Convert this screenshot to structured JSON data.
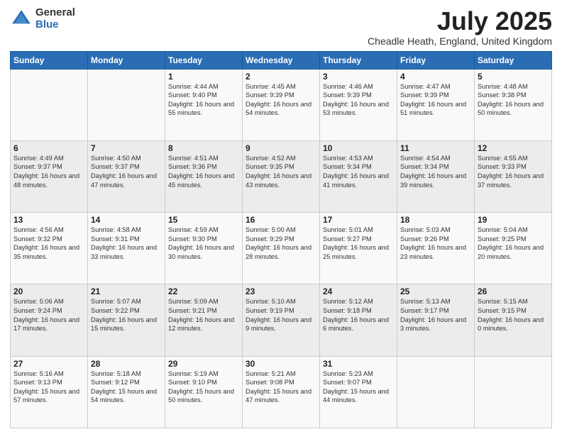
{
  "logo": {
    "general": "General",
    "blue": "Blue"
  },
  "title": {
    "main": "July 2025",
    "sub": "Cheadle Heath, England, United Kingdom"
  },
  "days_of_week": [
    "Sunday",
    "Monday",
    "Tuesday",
    "Wednesday",
    "Thursday",
    "Friday",
    "Saturday"
  ],
  "weeks": [
    [
      {
        "day": "",
        "info": ""
      },
      {
        "day": "",
        "info": ""
      },
      {
        "day": "1",
        "info": "Sunrise: 4:44 AM\nSunset: 9:40 PM\nDaylight: 16 hours and 55 minutes."
      },
      {
        "day": "2",
        "info": "Sunrise: 4:45 AM\nSunset: 9:39 PM\nDaylight: 16 hours and 54 minutes."
      },
      {
        "day": "3",
        "info": "Sunrise: 4:46 AM\nSunset: 9:39 PM\nDaylight: 16 hours and 53 minutes."
      },
      {
        "day": "4",
        "info": "Sunrise: 4:47 AM\nSunset: 9:39 PM\nDaylight: 16 hours and 51 minutes."
      },
      {
        "day": "5",
        "info": "Sunrise: 4:48 AM\nSunset: 9:38 PM\nDaylight: 16 hours and 50 minutes."
      }
    ],
    [
      {
        "day": "6",
        "info": "Sunrise: 4:49 AM\nSunset: 9:37 PM\nDaylight: 16 hours and 48 minutes."
      },
      {
        "day": "7",
        "info": "Sunrise: 4:50 AM\nSunset: 9:37 PM\nDaylight: 16 hours and 47 minutes."
      },
      {
        "day": "8",
        "info": "Sunrise: 4:51 AM\nSunset: 9:36 PM\nDaylight: 16 hours and 45 minutes."
      },
      {
        "day": "9",
        "info": "Sunrise: 4:52 AM\nSunset: 9:35 PM\nDaylight: 16 hours and 43 minutes."
      },
      {
        "day": "10",
        "info": "Sunrise: 4:53 AM\nSunset: 9:34 PM\nDaylight: 16 hours and 41 minutes."
      },
      {
        "day": "11",
        "info": "Sunrise: 4:54 AM\nSunset: 9:34 PM\nDaylight: 16 hours and 39 minutes."
      },
      {
        "day": "12",
        "info": "Sunrise: 4:55 AM\nSunset: 9:33 PM\nDaylight: 16 hours and 37 minutes."
      }
    ],
    [
      {
        "day": "13",
        "info": "Sunrise: 4:56 AM\nSunset: 9:32 PM\nDaylight: 16 hours and 35 minutes."
      },
      {
        "day": "14",
        "info": "Sunrise: 4:58 AM\nSunset: 9:31 PM\nDaylight: 16 hours and 33 minutes."
      },
      {
        "day": "15",
        "info": "Sunrise: 4:59 AM\nSunset: 9:30 PM\nDaylight: 16 hours and 30 minutes."
      },
      {
        "day": "16",
        "info": "Sunrise: 5:00 AM\nSunset: 9:29 PM\nDaylight: 16 hours and 28 minutes."
      },
      {
        "day": "17",
        "info": "Sunrise: 5:01 AM\nSunset: 9:27 PM\nDaylight: 16 hours and 25 minutes."
      },
      {
        "day": "18",
        "info": "Sunrise: 5:03 AM\nSunset: 9:26 PM\nDaylight: 16 hours and 23 minutes."
      },
      {
        "day": "19",
        "info": "Sunrise: 5:04 AM\nSunset: 9:25 PM\nDaylight: 16 hours and 20 minutes."
      }
    ],
    [
      {
        "day": "20",
        "info": "Sunrise: 5:06 AM\nSunset: 9:24 PM\nDaylight: 16 hours and 17 minutes."
      },
      {
        "day": "21",
        "info": "Sunrise: 5:07 AM\nSunset: 9:22 PM\nDaylight: 16 hours and 15 minutes."
      },
      {
        "day": "22",
        "info": "Sunrise: 5:09 AM\nSunset: 9:21 PM\nDaylight: 16 hours and 12 minutes."
      },
      {
        "day": "23",
        "info": "Sunrise: 5:10 AM\nSunset: 9:19 PM\nDaylight: 16 hours and 9 minutes."
      },
      {
        "day": "24",
        "info": "Sunrise: 5:12 AM\nSunset: 9:18 PM\nDaylight: 16 hours and 6 minutes."
      },
      {
        "day": "25",
        "info": "Sunrise: 5:13 AM\nSunset: 9:17 PM\nDaylight: 16 hours and 3 minutes."
      },
      {
        "day": "26",
        "info": "Sunrise: 5:15 AM\nSunset: 9:15 PM\nDaylight: 16 hours and 0 minutes."
      }
    ],
    [
      {
        "day": "27",
        "info": "Sunrise: 5:16 AM\nSunset: 9:13 PM\nDaylight: 15 hours and 57 minutes."
      },
      {
        "day": "28",
        "info": "Sunrise: 5:18 AM\nSunset: 9:12 PM\nDaylight: 15 hours and 54 minutes."
      },
      {
        "day": "29",
        "info": "Sunrise: 5:19 AM\nSunset: 9:10 PM\nDaylight: 15 hours and 50 minutes."
      },
      {
        "day": "30",
        "info": "Sunrise: 5:21 AM\nSunset: 9:08 PM\nDaylight: 15 hours and 47 minutes."
      },
      {
        "day": "31",
        "info": "Sunrise: 5:23 AM\nSunset: 9:07 PM\nDaylight: 15 hours and 44 minutes."
      },
      {
        "day": "",
        "info": ""
      },
      {
        "day": "",
        "info": ""
      }
    ]
  ]
}
